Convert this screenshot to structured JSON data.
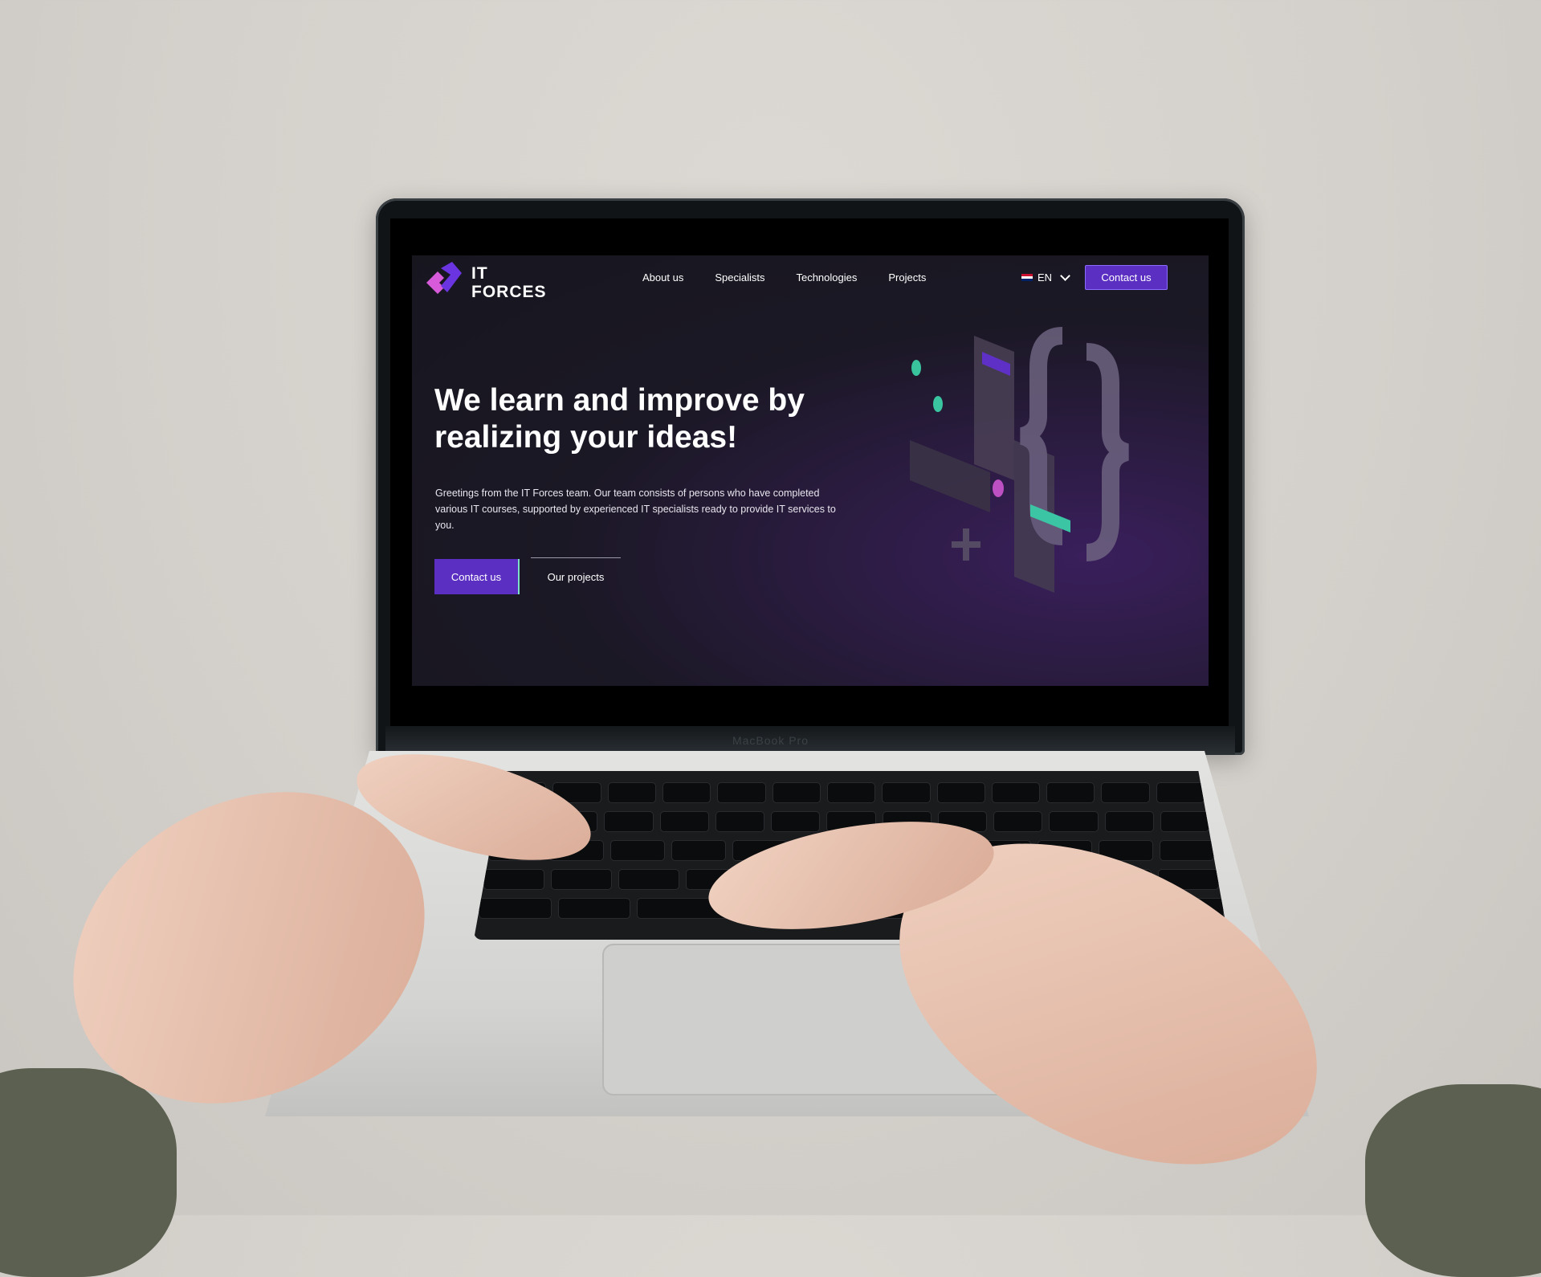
{
  "device": {
    "label": "MacBook Pro"
  },
  "website": {
    "logo": {
      "line1": "IT",
      "line2": "FORCES"
    },
    "nav": {
      "links": [
        "About us",
        "Specialists",
        "Technologies",
        "Projects"
      ],
      "language": "EN",
      "contact_label": "Contact us"
    },
    "hero": {
      "title": "We learn and improve by realizing your ideas!",
      "body": "Greetings from the IT Forces team. Our team consists of persons who have completed various IT courses, supported by experienced IT specialists ready to provide IT services to you.",
      "primary_button": "Contact us",
      "secondary_button": "Our projects"
    }
  },
  "colors": {
    "accent_purple": "#5b2fc2",
    "background_dark": "#17161f",
    "accent_teal": "#3ee3b3",
    "accent_pink": "#d65ad9"
  }
}
